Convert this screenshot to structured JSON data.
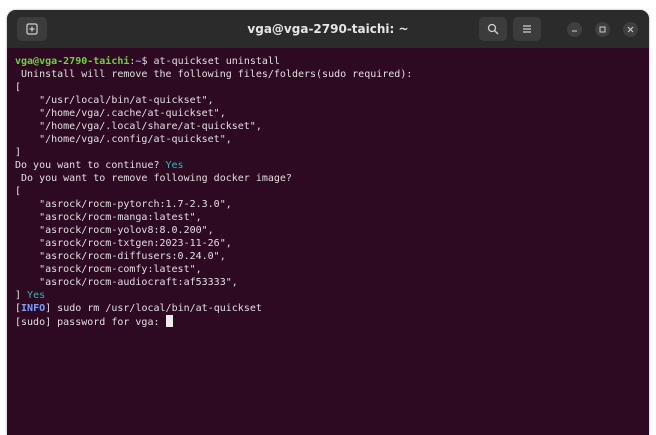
{
  "window": {
    "title": "vga@vga-2790-taichi: ~"
  },
  "titlebar": {
    "new_tab_icon": "new-tab-icon",
    "search_icon": "search-icon",
    "menu_icon": "hamburger-menu-icon",
    "min_icon": "minimize-icon",
    "max_icon": "maximize-icon",
    "close_icon": "close-icon"
  },
  "terminal": {
    "prompt_user": "vga@vga-2790-taichi",
    "prompt_path": "~",
    "prompt_symbol": "$",
    "command": "at-quickset uninstall",
    "uninstall_message": " Uninstall will remove the following files/folders(sudo required):",
    "open_bracket": "[",
    "close_bracket": "]",
    "files": [
      "    \"/usr/local/bin/at-quickset\",",
      "    \"/home/vga/.cache/at-quickset\",",
      "    \"/home/vga/.local/share/at-quickset\",",
      "    \"/home/vga/.config/at-quickset\","
    ],
    "continue_question": "Do you want to continue? ",
    "continue_answer": "Yes",
    "docker_question": " Do you want to remove following docker image?",
    "images": [
      "    \"asrock/rocm-pytorch:1.7-2.3.0\",",
      "    \"asrock/rocm-manga:latest\",",
      "    \"asrock/rocm-yolov8:8.0.200\",",
      "    \"asrock/rocm-txtgen:2023-11-26\",",
      "    \"asrock/rocm-diffusers:0.24.0\",",
      "    \"asrock/rocm-comfy:latest\",",
      "    \"asrock/rocm-audiocraft:af53333\","
    ],
    "images_answer": " Yes",
    "info_open": "[",
    "info_tag": "INFO",
    "info_close": "]",
    "info_command": " sudo rm /usr/local/bin/at-quickset",
    "sudo_prompt": "[sudo] password for vga: "
  },
  "colors": {
    "terminal_bg": "#2d0922",
    "prompt_user": "#6fd13c",
    "prompt_path": "#7aa1ff",
    "answer": "#2fb6b6"
  }
}
